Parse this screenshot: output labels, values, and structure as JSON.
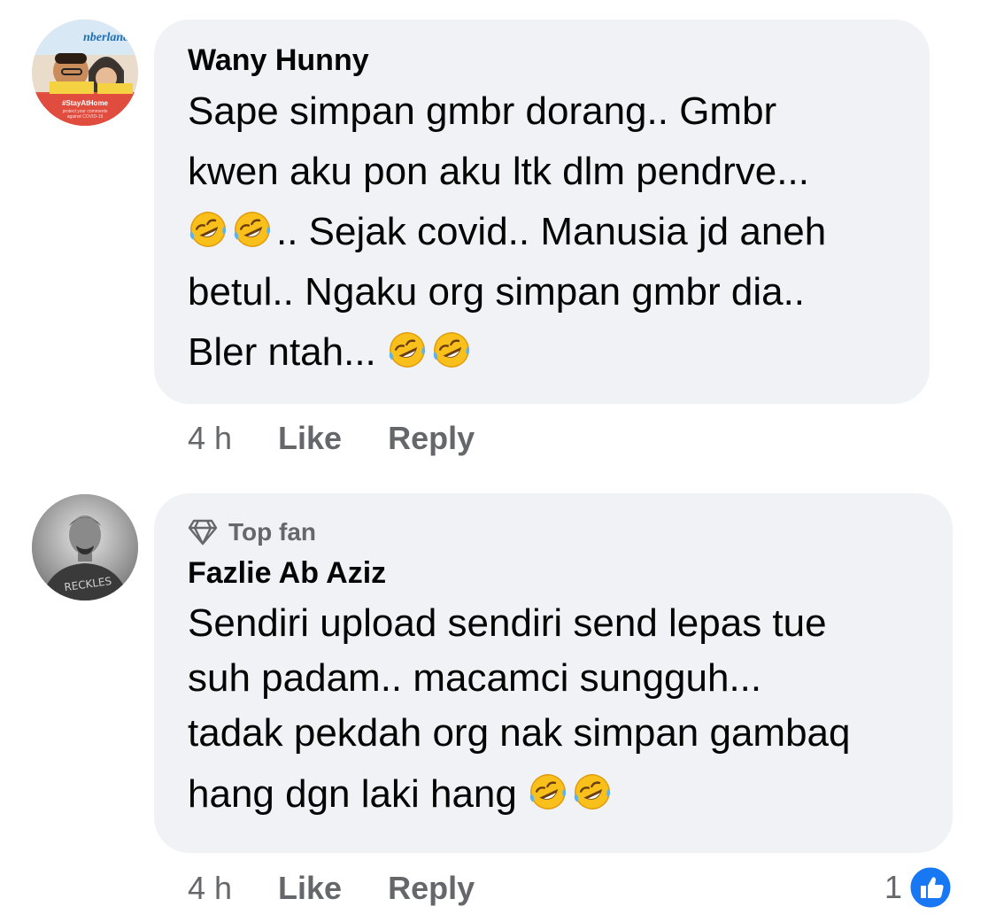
{
  "colors": {
    "bubble": "#f0f2f5",
    "muted": "#65676b",
    "like_blue": "#1877f2",
    "text": "#050505"
  },
  "comments": [
    {
      "author": "Wany Hunny",
      "avatar_caption": "#StayAtHome",
      "avatar_subcaption": "protect your comments against COVID-19",
      "lines": [
        "Sape simpan gmbr dorang.. Gmbr",
        "kwen aku pon aku ltk dlm pendrve...",
        ".. Sejak covid.. Manusia jd aneh",
        "betul.. Ngaku org simpan gmbr dia..",
        "Bler ntah... "
      ],
      "time": "4 h",
      "like_label": "Like",
      "reply_label": "Reply"
    },
    {
      "badge": "Top fan",
      "badge_icon": "diamond-icon",
      "author": "Fazlie Ab Aziz",
      "lines": [
        "Sendiri upload sendiri send lepas tue",
        "suh padam.. macamci sungguh...",
        "tadak pekdah org nak simpan gambaq",
        "hang dgn laki hang "
      ],
      "time": "4 h",
      "like_label": "Like",
      "reply_label": "Reply",
      "reaction_count": "1",
      "reaction_icon": "like-thumb-icon"
    }
  ]
}
